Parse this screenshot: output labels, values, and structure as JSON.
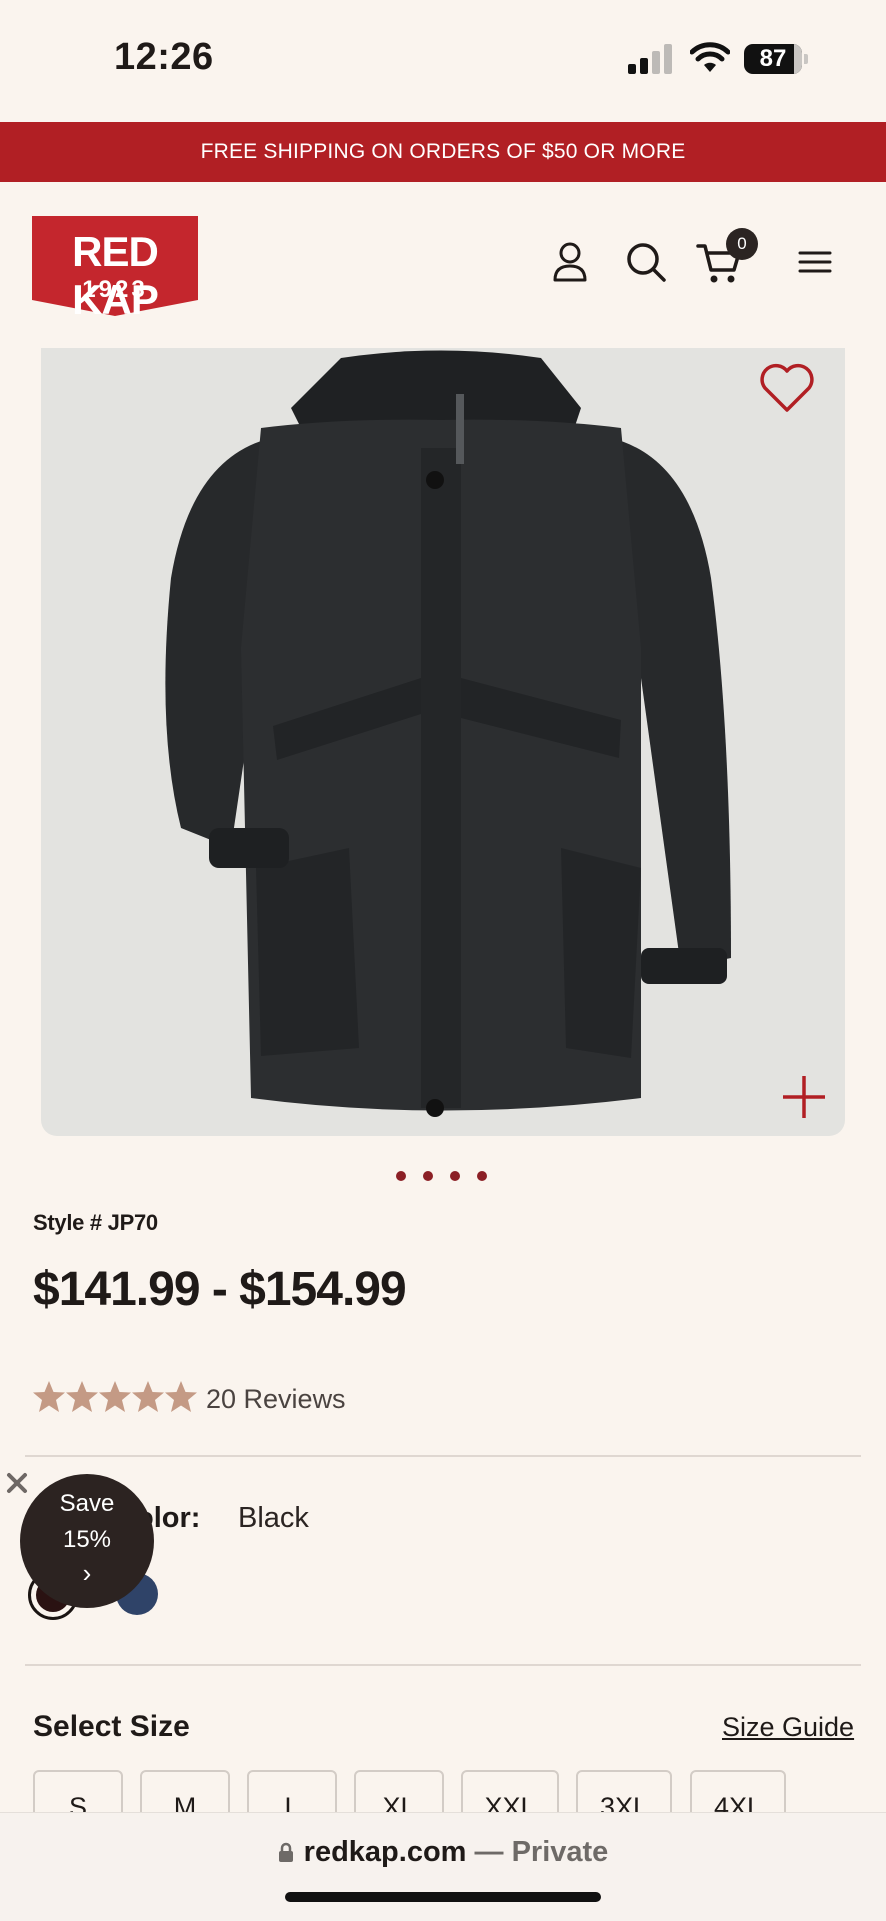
{
  "status_bar": {
    "time": "12:26",
    "battery": "87"
  },
  "promo": {
    "text": "FREE SHIPPING ON ORDERS OF $50 OR MORE"
  },
  "brand": {
    "name": "RED KAP",
    "year": "1923",
    "color": "#c4262d"
  },
  "header": {
    "cart_count": "0",
    "icons": [
      "account-icon",
      "search-icon",
      "cart-icon",
      "menu-icon"
    ]
  },
  "gallery": {
    "image": "black insulated parka jacket with hood",
    "slides": 4,
    "active_slide": 1
  },
  "product": {
    "style": "Style # JP70",
    "price": "$141.99 - $154.99",
    "rating": 5,
    "reviews": "20 Reviews"
  },
  "color": {
    "label": "olor:",
    "value": "Black",
    "swatches": [
      {
        "name": "Black",
        "hex": "#2a1212",
        "selected": true
      },
      {
        "name": "Navy",
        "hex": "#2f4368",
        "selected": false
      }
    ]
  },
  "save_popup": {
    "line1": "Save",
    "line2": "15%",
    "arrow": "›"
  },
  "size": {
    "title": "Select Size",
    "guide": "Size Guide",
    "options": [
      "S",
      "M",
      "L",
      "XL",
      "XXL",
      "3XL",
      "4XL"
    ]
  },
  "browser": {
    "domain": "redkap.com",
    "suffix": " — Private"
  },
  "colors": {
    "accent": "#b11f24",
    "background": "#faf4ee",
    "dot": "#8b1f25",
    "star": "#c49a85"
  }
}
